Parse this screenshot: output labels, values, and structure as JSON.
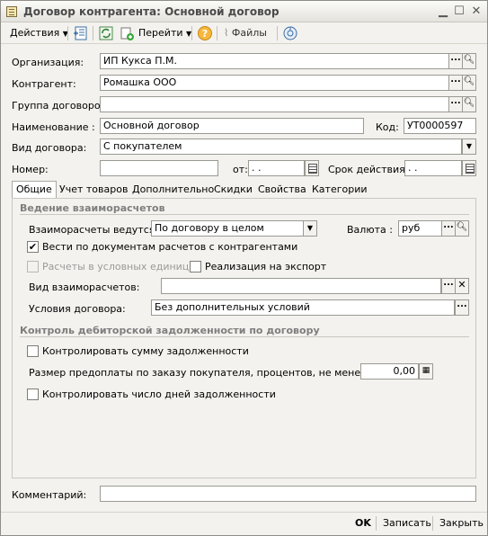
{
  "window": {
    "title": "Договор контрагента: Основной договор"
  },
  "toolbar": {
    "actions_label": "Действия",
    "goto_label": "Перейти",
    "files_label": "Файлы"
  },
  "form": {
    "organization": {
      "label": "Организация:",
      "value": "ИП Кукса П.М."
    },
    "counterparty": {
      "label": "Контрагент:",
      "value": "Ромашка ООО"
    },
    "contract_group": {
      "label": "Группа договоров:",
      "value": ""
    },
    "name": {
      "label": "Наименование :",
      "value": "Основной договор"
    },
    "code": {
      "label": "Код:",
      "value": "УТ0000597"
    },
    "contract_type": {
      "label": "Вид договора:",
      "value": "С покупателем"
    },
    "number": {
      "label": "Номер:",
      "value": ""
    },
    "date_from": {
      "label": "от:",
      "value": " .  ."
    },
    "validity": {
      "label": "Срок действия:",
      "value": " .  ."
    }
  },
  "tabs": [
    "Общие",
    "Учет товаров",
    "Дополнительно",
    "Скидки",
    "Свойства",
    "Категории"
  ],
  "general": {
    "settlements_header": "Ведение взаиморасчетов",
    "settlements_label": "Взаиморасчеты ведутся:",
    "settlements_value": "По договору в целом",
    "currency_label": "Валюта :",
    "currency_value": "руб",
    "by_documents_label": "Вести по документам расчетов с контрагентами",
    "by_documents_checked": true,
    "conditional_units_label": "Расчеты в условных единицах",
    "conditional_units_checked": false,
    "export_label": "Реализация на экспорт",
    "export_checked": false,
    "settlement_type_label": "Вид взаиморасчетов:",
    "settlement_type_value": "",
    "contract_terms_label": "Условия договора:",
    "contract_terms_value": "Без дополнительных условий",
    "debt_header": "Контроль дебиторской задолженности по договору",
    "control_debt_label": "Контролировать сумму задолженности",
    "control_debt_checked": false,
    "prepayment_label": "Размер предоплаты по заказу покупателя, процентов, не менее:",
    "prepayment_value": "0,00",
    "control_days_label": "Контролировать число дней задолженности",
    "control_days_checked": false
  },
  "comment": {
    "label": "Комментарий:",
    "value": ""
  },
  "footer": {
    "ok": "OK",
    "save": "Записать",
    "close": "Закрыть"
  }
}
